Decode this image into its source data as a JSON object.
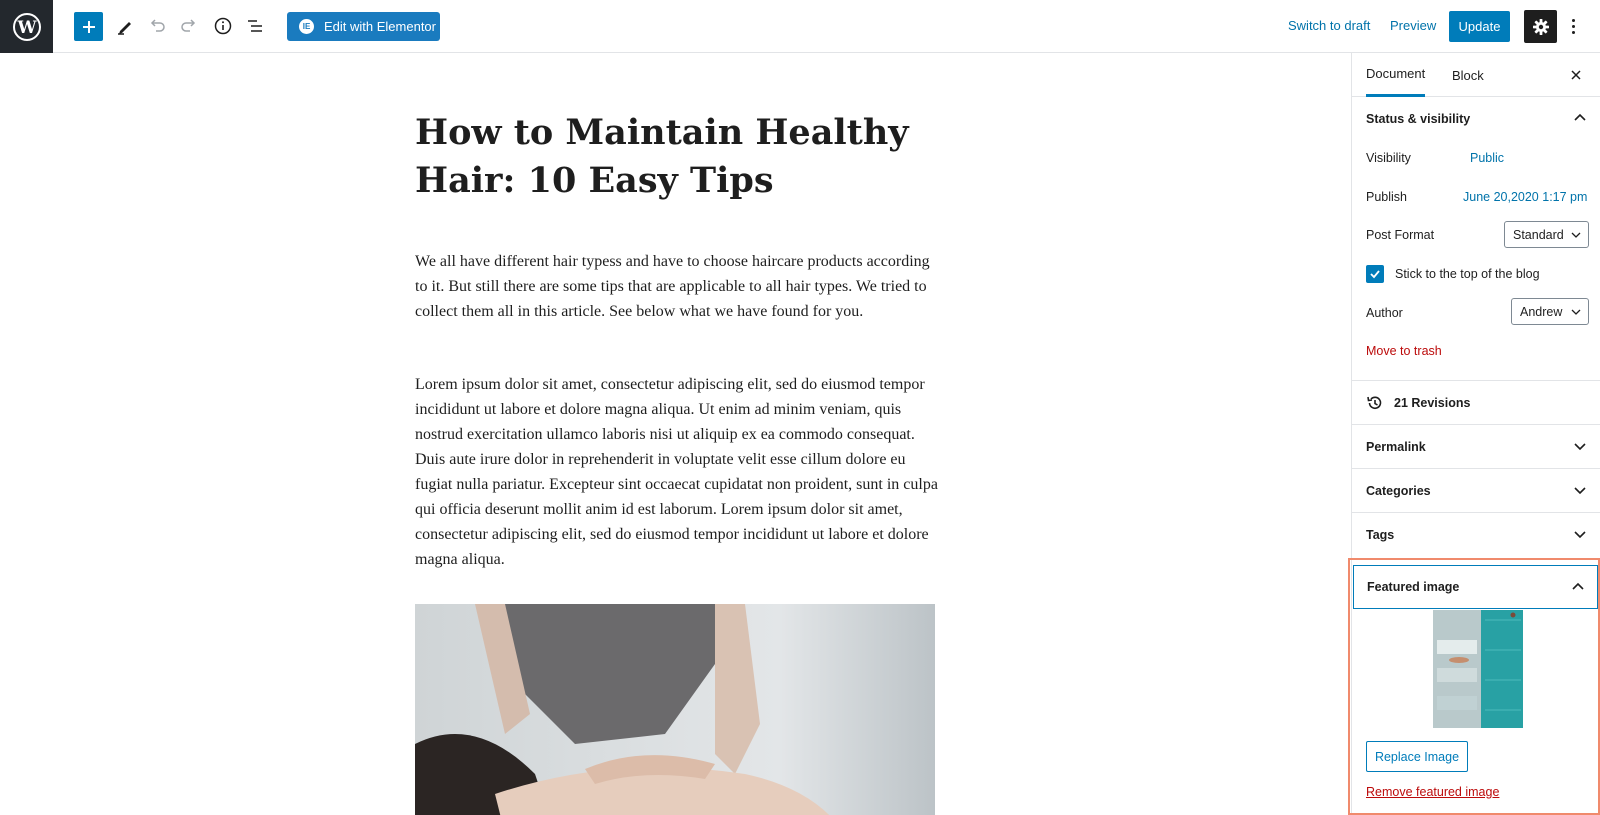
{
  "toolbar": {
    "elementor_label": "Edit with Elementor",
    "switch_to_draft": "Switch to draft",
    "preview": "Preview",
    "update": "Update",
    "icons": [
      "wordpress-logo",
      "add-block-icon",
      "edit-tools-icon",
      "undo-icon",
      "redo-icon",
      "info-icon",
      "list-view-icon",
      "settings-gear-icon",
      "more-options-icon"
    ]
  },
  "post": {
    "title": "How to Maintain Healthy Hair: 10 Easy Tips",
    "paragraph1": "We all have different hair typess and have to choose haircare products according to it. But still there are some tips that are applicable to all hair types. We tried to collect them all in this article. See below what we have found for you.",
    "paragraph2": "Lorem ipsum dolor sit amet, consectetur adipiscing elit, sed do eiusmod tempor incididunt ut labore et dolore magna aliqua. Ut enim ad minim veniam, quis nostrud exercitation ullamco laboris nisi ut aliquip ex ea commodo consequat. Duis aute irure dolor in reprehenderit in voluptate velit esse cillum dolore eu fugiat nulla pariatur. Excepteur sint occaecat cupidatat non proident, sunt in culpa qui officia deserunt mollit anim id est laborum. Lorem ipsum dolor sit amet, consectetur adipiscing elit, sed do eiusmod tempor incididunt ut labore et dolore magna aliqua."
  },
  "sidebar": {
    "tabs": [
      "Document",
      "Block"
    ],
    "status_visibility": {
      "heading": "Status & visibility",
      "visibility_label": "Visibility",
      "visibility_value": "Public",
      "publish_label": "Publish",
      "publish_value": "June 20,2020 1:17 pm",
      "format_label": "Post Format",
      "format_value": "Standard",
      "sticky_label": "Stick to the top of the blog",
      "sticky_checked": true,
      "author_label": "Author",
      "author_value": "Andrew",
      "trash_label": "Move to trash"
    },
    "revisions": "21 Revisions",
    "panels": [
      "Permalink",
      "Categories",
      "Tags"
    ],
    "featured": {
      "heading": "Featured image",
      "replace_label": "Replace Image",
      "remove_label": "Remove featured image"
    }
  },
  "colors": {
    "accent": "#007cba",
    "link": "#0073aa",
    "danger": "#bc0b0b",
    "highlight": "#f08a6c",
    "dark": "#23282d"
  }
}
